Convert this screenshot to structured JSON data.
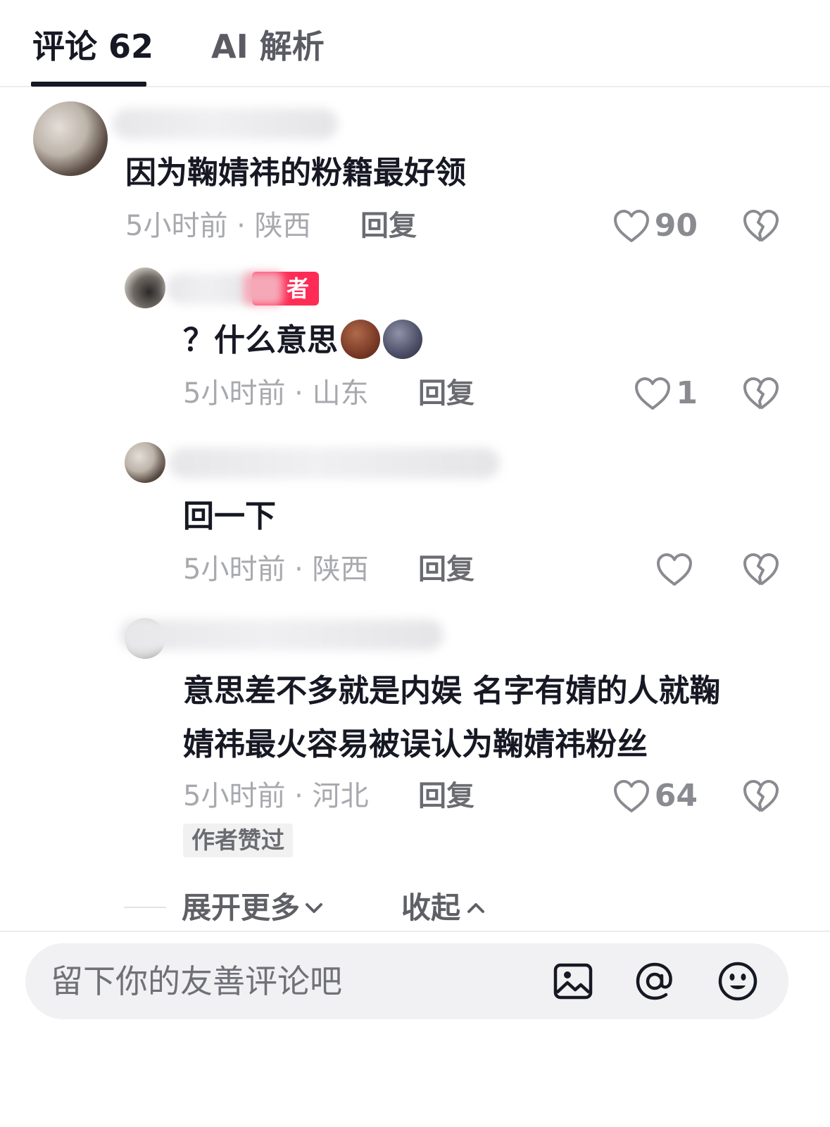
{
  "tabs": {
    "comments_label": "评论 62",
    "ai_label": "AI 解析"
  },
  "comments": [
    {
      "avatar": "user-avatar",
      "text": "因为鞠婧祎的粉籍最好领",
      "time_location": "5小时前 · 陕西",
      "reply_label": "回复",
      "likes": "90"
    }
  ],
  "replies": [
    {
      "badge": "者",
      "text": "？什么意思",
      "emojis": [
        "smirk-emoji",
        "moon-face-emoji"
      ],
      "time_location": "5小时前 · 山东",
      "reply_label": "回复",
      "likes": "1"
    },
    {
      "text": "回一下",
      "time_location": "5小时前 · 陕西",
      "reply_label": "回复",
      "likes": ""
    },
    {
      "text_line1": "意思差不多就是内娱 名字有婧的人就鞠",
      "text_line2": "婧祎最火容易被误认为鞠婧祎粉丝",
      "time_location": "5小时前 · 河北",
      "reply_label": "回复",
      "likes": "64",
      "tag": "作者赞过"
    }
  ],
  "thread_controls": {
    "expand_label": "展开更多",
    "collapse_label": "收起"
  },
  "input": {
    "placeholder": "留下你的友善评论吧",
    "icons": [
      "image-icon",
      "at-icon",
      "emoji-icon"
    ]
  }
}
